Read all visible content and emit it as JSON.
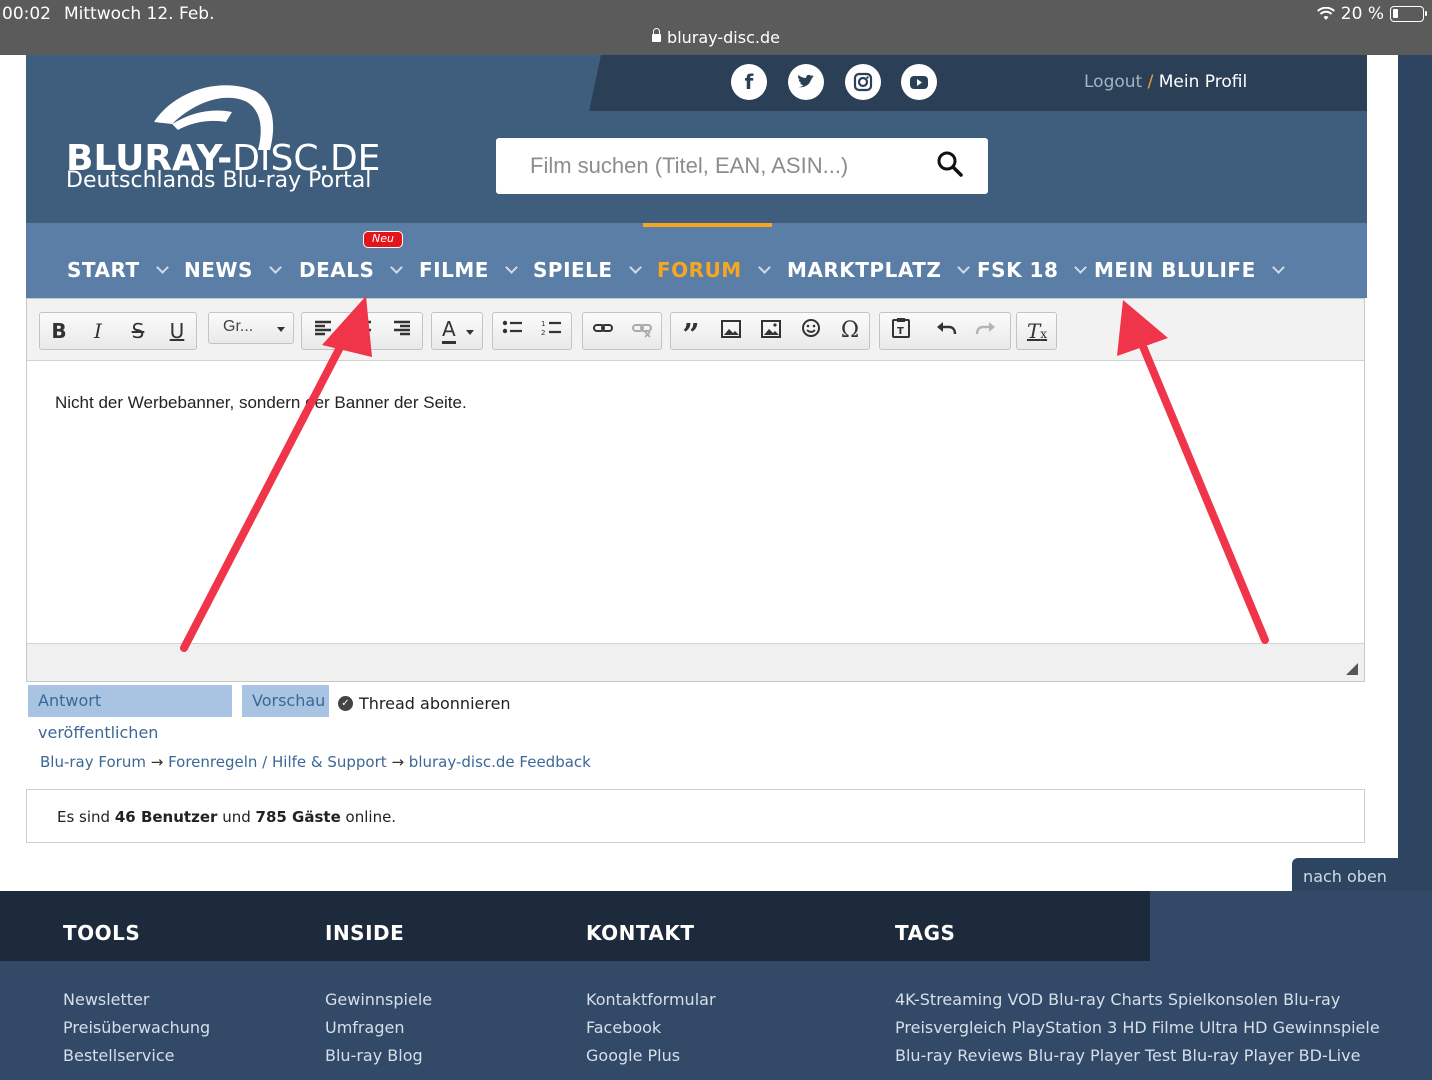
{
  "status_bar": {
    "time": "00:02",
    "date": "Mittwoch 12. Feb.",
    "url": "bluray-disc.de",
    "battery": "20 %"
  },
  "header": {
    "logo_bold": "BLURAY-",
    "logo_thin": "DISC.DE",
    "logo_tagline": "Deutschlands Blu-ray Portal",
    "social": [
      "facebook-icon",
      "twitter-icon",
      "instagram-icon",
      "youtube-icon"
    ],
    "logout": "Logout",
    "separator": "/",
    "profile": "Mein Profil",
    "search_placeholder": "Film suchen (Titel, EAN, ASIN...)"
  },
  "nav": {
    "items": [
      {
        "label": "START"
      },
      {
        "label": "NEWS"
      },
      {
        "label": "DEALS"
      },
      {
        "label": "FILME"
      },
      {
        "label": "SPIELE"
      },
      {
        "label": "FORUM"
      },
      {
        "label": "MARKTPLATZ"
      },
      {
        "label": "FSK 18"
      },
      {
        "label": "MEIN BLULIFE"
      }
    ],
    "active": "FORUM",
    "badge": "Neu"
  },
  "editor": {
    "font_select": "Gr...",
    "content": "Nicht der Werbebanner, sondern der Banner der Seite."
  },
  "actions": {
    "publish": "Antwort veröffentlichen",
    "preview": "Vorschau",
    "subscribe": "Thread abonnieren",
    "subscribe_checked": true
  },
  "breadcrumb": {
    "items": [
      "Blu-ray Forum",
      "Forenregeln / Hilfe & Support",
      "bluray-disc.de Feedback"
    ],
    "arrow": "→"
  },
  "online": {
    "prefix": "Es sind",
    "users": "46 Benutzer",
    "middle": "und",
    "guests": "785 Gäste",
    "suffix": "online."
  },
  "back_to_top": "nach oben",
  "footer": {
    "columns": [
      {
        "title": "TOOLS",
        "links": [
          "Newsletter",
          "Preisüberwachung",
          "Bestellservice"
        ]
      },
      {
        "title": "INSIDE",
        "links": [
          "Gewinnspiele",
          "Umfragen",
          "Blu-ray Blog"
        ]
      },
      {
        "title": "KONTAKT",
        "links": [
          "Kontaktformular",
          "Facebook",
          "Google Plus"
        ]
      },
      {
        "title": "TAGS",
        "links": [
          "4K-Streaming VOD Blu-ray Charts Spielkonsolen Blu-ray",
          "Preisvergleich PlayStation 3 HD Filme Ultra HD Gewinnspiele",
          "Blu-ray Reviews Blu-ray Player Test Blu-ray Player BD-Live"
        ]
      }
    ]
  },
  "colors": {
    "header_bg": "#3f5d7c",
    "nav_bg": "#5a7ea5",
    "accent": "#f5a623",
    "arrow": "#f0354a",
    "footer_bg": "#324a68"
  }
}
